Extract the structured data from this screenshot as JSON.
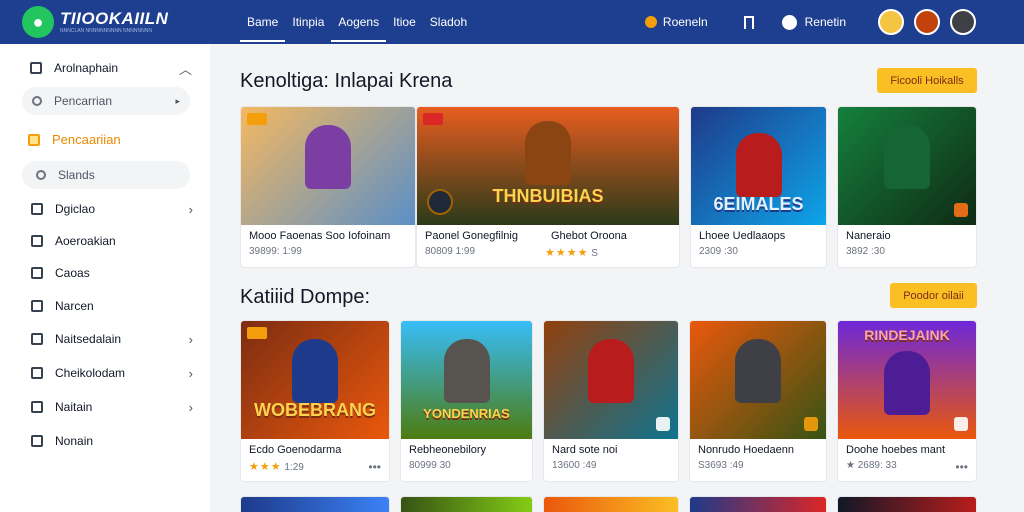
{
  "header": {
    "logo_title": "TIIOOKAIILN",
    "logo_sub": "NNNCLAN NNNNNNNNNN NNNNNNNN",
    "nav": [
      {
        "label": "Bame",
        "active": true
      },
      {
        "label": "Itinpia",
        "active": false
      },
      {
        "label": "Aogens",
        "active": true
      },
      {
        "label": "Itioe",
        "active": false
      },
      {
        "label": "Sladoh",
        "active": false
      }
    ],
    "coins_label": "Roeneln",
    "chat_label": "Renetin",
    "colors": {
      "bar": "#1e3f8f",
      "accent": "#fbbf24"
    }
  },
  "sidebar": {
    "top_label": "Arolnaphain",
    "search_placeholder": "Pencarrian",
    "accent_label": "Pencaariian",
    "stands_placeholder": "Slands",
    "items": [
      {
        "label": "Dgiclao",
        "icon": "calendar-icon",
        "chevron": true
      },
      {
        "label": "Aoeroakian",
        "icon": "tag-icon",
        "chevron": false
      },
      {
        "label": "Caoas",
        "icon": "ticket-icon",
        "chevron": false
      },
      {
        "label": "Narcen",
        "icon": "book-icon",
        "chevron": false
      },
      {
        "label": "Naitsedalain",
        "icon": "shield-icon",
        "chevron": true
      },
      {
        "label": "Cheikolodam",
        "icon": "controller-icon",
        "chevron": true
      },
      {
        "label": "Naitain",
        "icon": "camera-icon",
        "chevron": true
      },
      {
        "label": "Nonain",
        "icon": "grid-icon",
        "chevron": false
      }
    ]
  },
  "sections": [
    {
      "title": "Kenoltiga: Inlapai Krena",
      "cta": "Ficooli Hoikalls",
      "cards": [
        {
          "name": "Mooo Faoenas Soo Iofoinam",
          "meta": "39899: 1:99",
          "art": "",
          "stars": "",
          "bg": [
            "#f4b860",
            "#5b8fc7"
          ],
          "fig": "#7b3fa3"
        },
        {
          "name": "Paonel Gonegfilnig",
          "meta": "80809 1:99",
          "art": "THNBUIBIAS",
          "stars": "",
          "bg": [
            "#e85d1f",
            "#2a3a1a"
          ],
          "fig": "#8b4513"
        },
        {
          "name": "Ghebot Oroona",
          "meta": "",
          "art": "",
          "stars": "★★★★",
          "stars_suffix": "S",
          "bg": [
            "#3b7a2b",
            "#1a2e12"
          ],
          "fig": "#c2410c"
        },
        {
          "name": "Lhoee Uedlaaops",
          "meta": "2309 :30",
          "art": "6EIMALES",
          "stars": "",
          "bg": [
            "#1e3a8a",
            "#0ea5e9"
          ],
          "fig": "#b91c1c"
        },
        {
          "name": "Naneraio",
          "meta": "3892 :30",
          "art": "",
          "stars": "",
          "bg": [
            "#15803d",
            "#0f2a14"
          ],
          "fig": "#166534"
        }
      ]
    },
    {
      "title": "Katiiid Dompe:",
      "cta": "Poodor oilaii",
      "cards": [
        {
          "name": "Ecdo Goenodarma",
          "meta": "1:29",
          "stars": "★★★",
          "art": "WOBEBRANG",
          "bg": [
            "#7c2d12",
            "#ea580c"
          ],
          "fig": "#1e3a8a"
        },
        {
          "name": "Rebheonebilory",
          "meta": "80999 30",
          "stars": "",
          "art": "YONDENRIAS",
          "bg": [
            "#4d7c0f",
            "#38bdf8"
          ],
          "fig": "#57534e"
        },
        {
          "name": "Nard sote noi",
          "meta": "13600 :49",
          "stars": "",
          "art": "",
          "bg": [
            "#92400e",
            "#0e7490"
          ],
          "fig": "#b91c1c"
        },
        {
          "name": "Nonrudo Hoedaenn",
          "meta": "S3693 :49",
          "stars": "",
          "art": "",
          "bg": [
            "#ea580c",
            "#365314"
          ],
          "fig": "#3f3f46"
        },
        {
          "name": "Doohe hoebes mant",
          "meta": "★ 2689: 33",
          "stars": "",
          "art": "RINDEJAINK",
          "bg": [
            "#6d28d9",
            "#ea580c"
          ],
          "fig": "#4c1d95"
        }
      ]
    }
  ]
}
